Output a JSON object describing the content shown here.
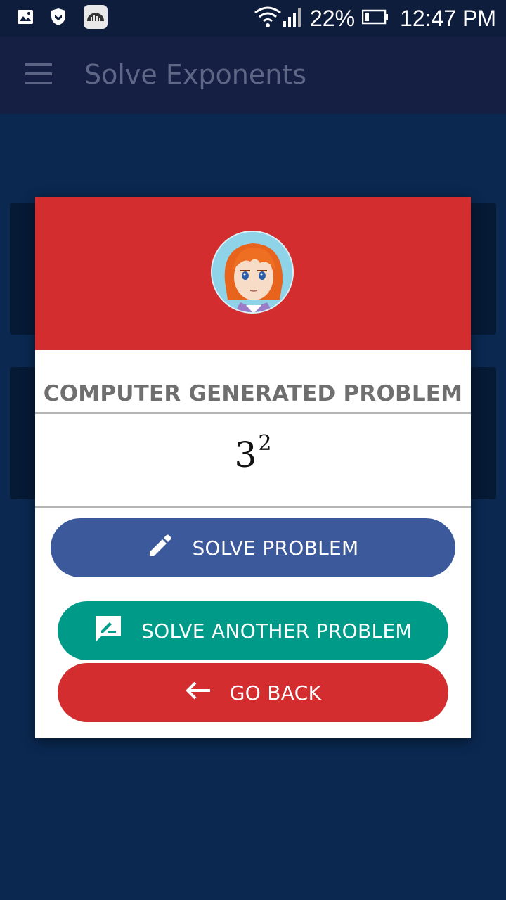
{
  "status_bar": {
    "battery_percent": "22%",
    "time": "12:47 PM",
    "icons": [
      "gallery-icon",
      "shield-icon",
      "soundcloud-icon",
      "wifi-icon",
      "signal-icon",
      "battery-icon"
    ]
  },
  "app_bar": {
    "title": "Solve Exponents",
    "menu_icon": "hamburger-menu-icon"
  },
  "dialog": {
    "heading": "COMPUTER GENERATED PROBLEM",
    "expression": {
      "base": "3",
      "exponent": "2"
    },
    "buttons": {
      "solve": {
        "label": "SOLVE PROBLEM",
        "icon": "pencil-icon"
      },
      "another": {
        "label": "SOLVE ANOTHER PROBLEM",
        "icon": "comment-edit-icon"
      },
      "back": {
        "label": "GO BACK",
        "icon": "arrow-left-icon"
      }
    }
  },
  "colors": {
    "app_bar": "#151f43",
    "background": "#0a2850",
    "header_red": "#d32d2f",
    "solve_blue": "#3c5a9b",
    "another_teal": "#009a88",
    "back_red": "#d32d2f"
  }
}
